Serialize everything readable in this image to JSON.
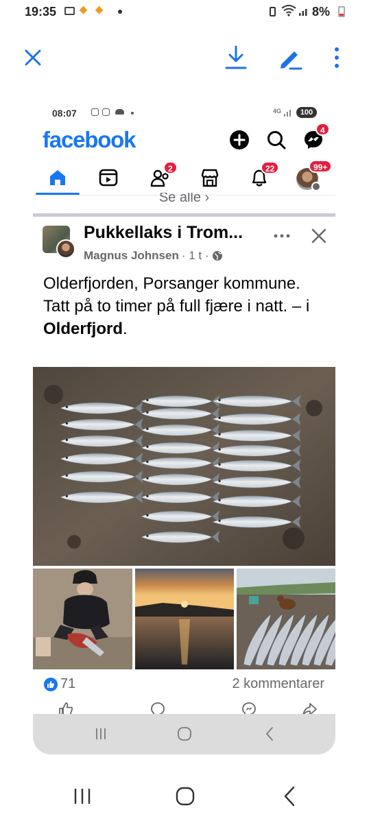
{
  "phone_status": {
    "time": "19:35",
    "battery": "8%",
    "notification_icons": [
      "gallery-icon",
      "tag-icon",
      "tag-icon",
      "dot"
    ]
  },
  "viewer_toolbar": {
    "icons": [
      "close-icon",
      "download-icon",
      "edit-pen-icon",
      "more-vertical-icon"
    ],
    "accent": "#1a73e8"
  },
  "screenshot": {
    "status": {
      "time": "08:07",
      "network": "4G",
      "battery": "100"
    },
    "app": {
      "logo": "facebook",
      "brand_color": "#1877f2",
      "messenger_badge": "4"
    },
    "nav": {
      "friends_badge": "2",
      "notifications_badge": "22",
      "profile_badge": "99+"
    },
    "see_all": "Se alle ›",
    "post": {
      "group_name": "Pukkellaks i Trom...",
      "author": "Magnus Johnsen",
      "time": "· 1 t ·",
      "line1": "Olderfjorden, Porsanger kommune.",
      "line2_prefix": "Tatt på to timer på full fjære i natt. – i ",
      "place": "Olderfjord",
      "line2_suffix": ".",
      "likes": "71",
      "comments": "2 kommentarer"
    }
  }
}
